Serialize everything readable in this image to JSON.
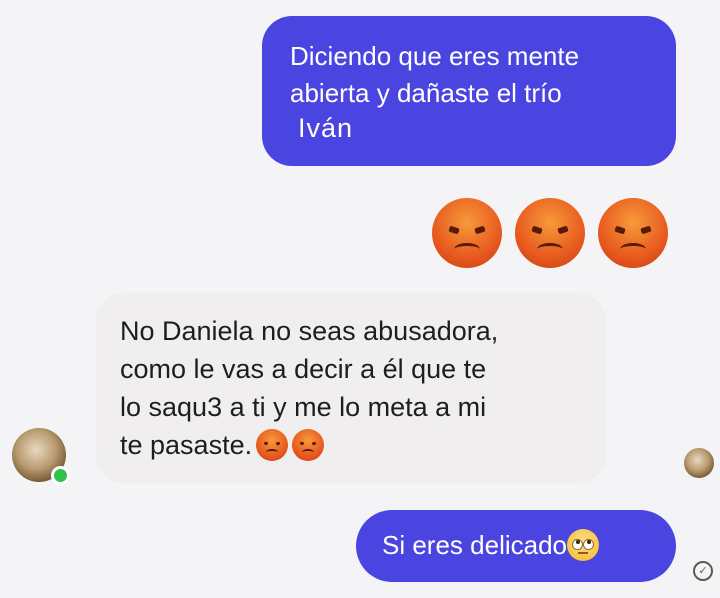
{
  "messages": {
    "outgoing_1": {
      "lines": [
        "Diciendo que eres mente",
        "abierta y dañaste el trío"
      ],
      "overlay_text": "Iván"
    },
    "reaction_emojis": [
      "angry-face",
      "angry-face",
      "angry-face"
    ],
    "incoming_1": {
      "lines": [
        "No Daniela no seas abusadora,",
        "como le vas a decir a él que te",
        "lo saqu3 a ti y me lo meta a mi",
        "te pasaste."
      ],
      "trailing_emojis": [
        "angry-face",
        "angry-face"
      ]
    },
    "outgoing_2": {
      "text": "Si eres delicado",
      "trailing_emoji": "face-with-rolling-eyes"
    }
  },
  "colors": {
    "outgoing_bubble": "#4a45e0",
    "incoming_bubble": "#f0eeef",
    "background": "#f4f4f6",
    "online_dot": "#31c24a"
  },
  "icons": {
    "sent_status": "check-circle-icon",
    "seen_status": "seen-avatar"
  }
}
